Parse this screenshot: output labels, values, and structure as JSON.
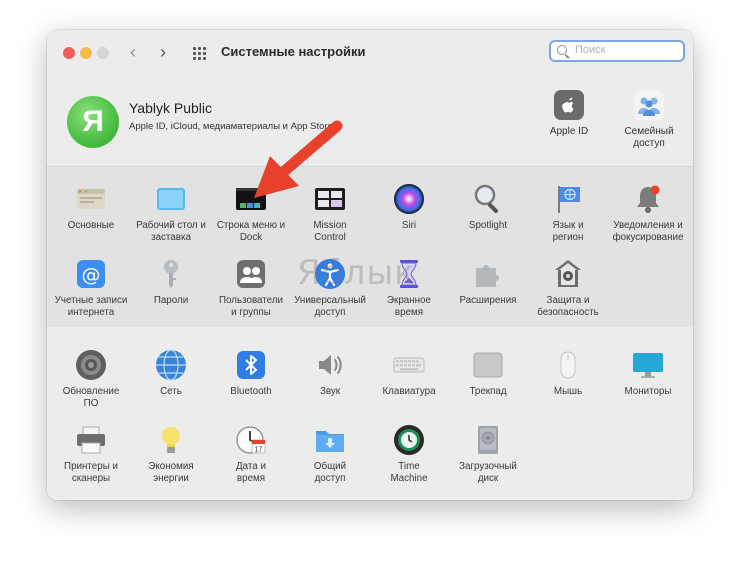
{
  "window": {
    "title": "Системные настройки"
  },
  "search": {
    "placeholder": "Поиск"
  },
  "account": {
    "avatar_letter": "Я",
    "name": "Yablyk Public",
    "subtitle": "Apple ID, iCloud, медиаматериалы и App Store",
    "items": [
      {
        "label": "Apple ID",
        "icon": "apple-id-icon"
      },
      {
        "label": "Семейный доступ",
        "icon": "family-sharing-icon"
      }
    ]
  },
  "section1": {
    "row1": [
      {
        "label": "Основные",
        "icon": "general-icon"
      },
      {
        "label": "Рабочий стол и заставка",
        "icon": "desktop-screensaver-icon"
      },
      {
        "label": "Строка меню и Dock",
        "icon": "menubar-dock-icon"
      },
      {
        "label": "Mission Control",
        "icon": "mission-control-icon"
      },
      {
        "label": "Siri",
        "icon": "siri-icon"
      },
      {
        "label": "Spotlight",
        "icon": "spotlight-icon"
      },
      {
        "label": "Язык и регион",
        "icon": "language-region-icon"
      },
      {
        "label": "Уведомления и фокусирование",
        "icon": "notifications-icon"
      }
    ],
    "row2": [
      {
        "label": "Учетные записи интернета",
        "icon": "internet-accounts-icon"
      },
      {
        "label": "Пароли",
        "icon": "passwords-icon"
      },
      {
        "label": "Пользователи и группы",
        "icon": "users-groups-icon"
      },
      {
        "label": "Универсальный доступ",
        "icon": "accessibility-icon"
      },
      {
        "label": "Экранное время",
        "icon": "screen-time-icon"
      },
      {
        "label": "Расширения",
        "icon": "extensions-icon"
      },
      {
        "label": "Защита и безопасность",
        "icon": "security-privacy-icon"
      }
    ]
  },
  "section2": {
    "row1": [
      {
        "label": "Обновление ПО",
        "icon": "software-update-icon"
      },
      {
        "label": "Сеть",
        "icon": "network-icon"
      },
      {
        "label": "Bluetooth",
        "icon": "bluetooth-icon"
      },
      {
        "label": "Звук",
        "icon": "sound-icon"
      },
      {
        "label": "Клавиатура",
        "icon": "keyboard-icon"
      },
      {
        "label": "Трекпад",
        "icon": "trackpad-icon"
      },
      {
        "label": "Мышь",
        "icon": "mouse-icon"
      },
      {
        "label": "Мониторы",
        "icon": "displays-icon"
      }
    ],
    "row2": [
      {
        "label": "Принтеры и сканеры",
        "icon": "printers-scanners-icon"
      },
      {
        "label": "Экономия энергии",
        "icon": "energy-saver-icon"
      },
      {
        "label": "Дата и время",
        "icon": "date-time-icon"
      },
      {
        "label": "Общий доступ",
        "icon": "sharing-icon"
      },
      {
        "label": "Time Machine",
        "icon": "time-machine-icon"
      },
      {
        "label": "Загрузочный диск",
        "icon": "startup-disk-icon"
      }
    ]
  },
  "watermark": "Яблык",
  "colors": {
    "arrow": "#e8412c",
    "avatar": "#3fb83c",
    "search_focus": "#7ba6e8"
  }
}
